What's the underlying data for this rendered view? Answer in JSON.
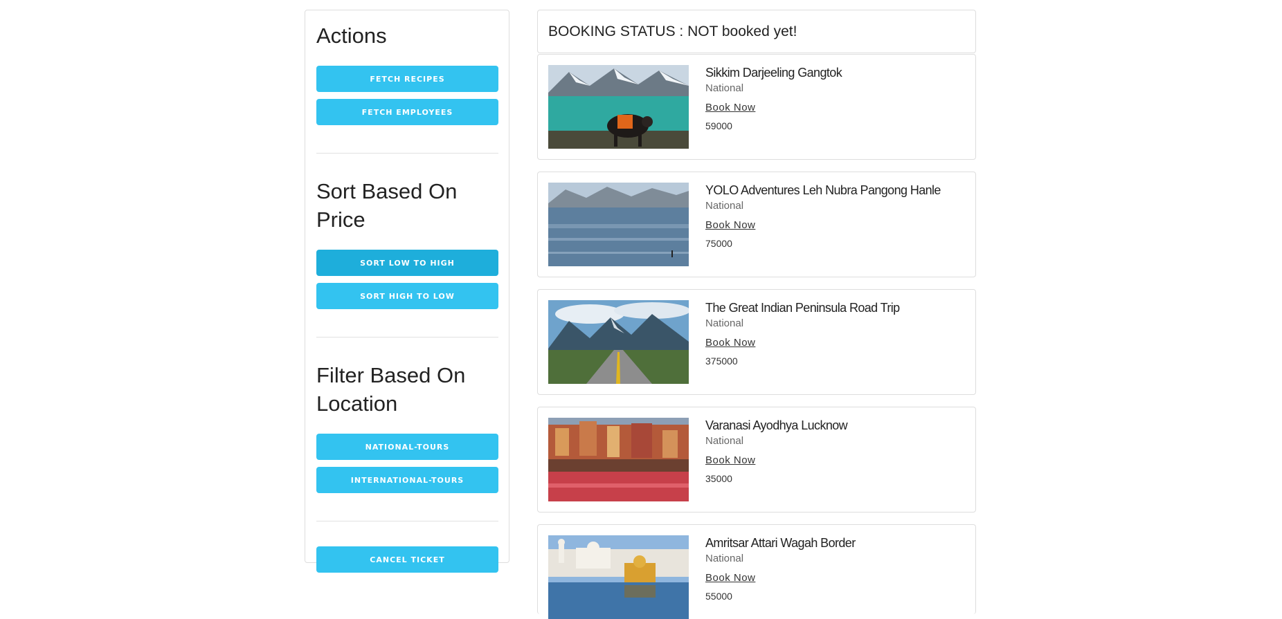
{
  "sidebar": {
    "actions_title": "Actions",
    "fetch_recipes_label": "FETCH RECIPES",
    "fetch_employees_label": "FETCH EMPLOYEES",
    "sort_title": "Sort Based On Price",
    "sort_low_high_label": "SORT LOW TO HIGH",
    "sort_high_low_label": "SORT HIGH TO LOW",
    "filter_title": "Filter Based On Location",
    "national_label": "NATIONAL-TOURS",
    "international_label": "INTERNATIONAL-TOURS",
    "cancel_label": "CANCEL TICKET"
  },
  "booking_status": "BOOKING STATUS : NOT booked yet!",
  "tours": [
    {
      "title": "Sikkim Darjeeling Gangtok",
      "category": "National",
      "book_label": "Book Now",
      "price": "59000"
    },
    {
      "title": "YOLO Adventures Leh Nubra Pangong Hanle",
      "category": "National",
      "book_label": "Book Now",
      "price": "75000"
    },
    {
      "title": "The Great Indian Peninsula Road Trip",
      "category": "National",
      "book_label": "Book Now",
      "price": "375000"
    },
    {
      "title": "Varanasi Ayodhya Lucknow",
      "category": "National",
      "book_label": "Book Now",
      "price": "35000"
    },
    {
      "title": "Amritsar Attari Wagah Border",
      "category": "National",
      "book_label": "Book Now",
      "price": "55000"
    }
  ],
  "colors": {
    "button": "#33c3f0",
    "button_active": "#1eaedb",
    "border": "#dddddd"
  }
}
